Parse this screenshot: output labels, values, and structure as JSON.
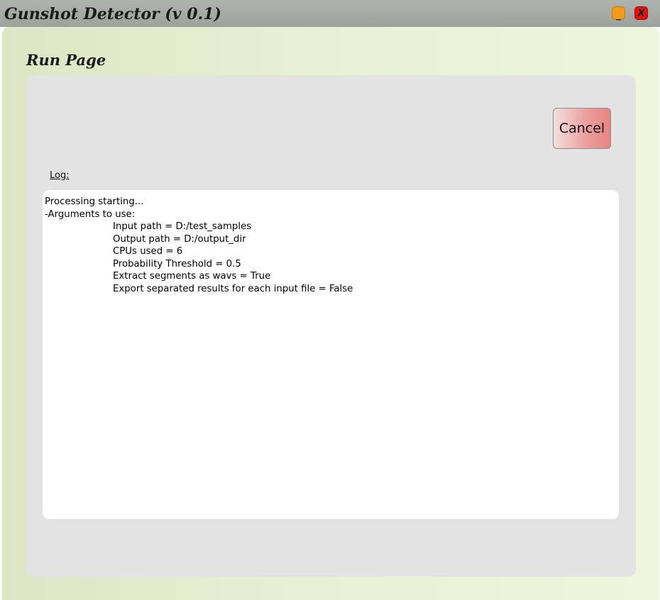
{
  "window": {
    "title": "Gunshot Detector (v 0.1)",
    "minimize_label": "_",
    "close_label": "X"
  },
  "page": {
    "title": "Run Page",
    "cancel_label": "Cancel",
    "log_label": "Log:",
    "log_lines": [
      "Processing starting...",
      "-Arguments to use:",
      "Input path = D:/test_samples",
      "Output path = D:/output_dir",
      "CPUs used = 6",
      "Probability Threshold = 0.5",
      "Extract segments as wavs = True",
      "Export separated results for each input file = False"
    ]
  },
  "colors": {
    "titlebar": "#a4a9a3",
    "background_left": "#dde5c5",
    "background_right": "#edf6dc",
    "panel": "#e3e3e3",
    "cancel_button": "#ec9c9c",
    "minimize_button": "#f29b1b",
    "close_button": "#e81010"
  }
}
